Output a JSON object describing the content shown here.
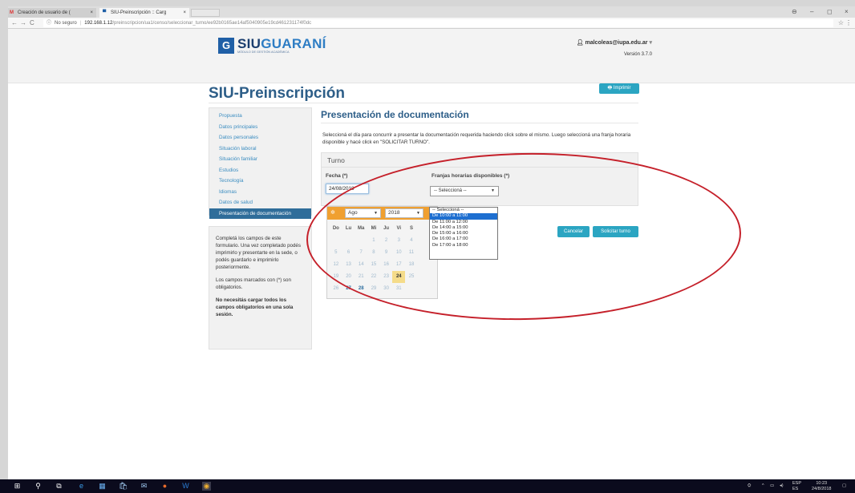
{
  "browser": {
    "tabs": [
      {
        "label": "Creación de usuario de (",
        "icon": "gmail-icon"
      },
      {
        "label": "SIU-Preinscripción :: Carg",
        "icon": "siu-icon"
      }
    ],
    "close_glyph": "×",
    "url_security": "No seguro",
    "url_host": "192.168.1.12",
    "url_path": "/preinscripcion/ua1/censo/seleccionar_turno/ee92b0165ae14af5040905e19cd461231174f0dc",
    "window_controls": {
      "profile": "⊖",
      "minimize": "–",
      "maximize": "◻",
      "close": "×"
    }
  },
  "header": {
    "logo_mark": "G",
    "logo_siu": "SIU",
    "logo_guarani": "GUARANÍ",
    "logo_subtitle": "MÓDULO DE GESTIÓN ACADÉMICA",
    "user_email": "malcoleas@iupa.edu.ar",
    "version": "Versión 3.7.0"
  },
  "page": {
    "title": "SIU-Preinscripción",
    "print_button": "Imprimir"
  },
  "sidebar": {
    "items": [
      {
        "label": "Propuesta",
        "active": false
      },
      {
        "label": "Datos principales",
        "active": false
      },
      {
        "label": "Datos personales",
        "active": false
      },
      {
        "label": "Situación laboral",
        "active": false
      },
      {
        "label": "Situación familiar",
        "active": false
      },
      {
        "label": "Estudios",
        "active": false
      },
      {
        "label": "Tecnología",
        "active": false
      },
      {
        "label": "Idiomas",
        "active": false
      },
      {
        "label": "Datos de salud",
        "active": false
      },
      {
        "label": "Presentación de documentación",
        "active": true
      }
    ],
    "info": {
      "p1": "Completá los campos de este formulario. Una vez completado podés imprimirlo y presentarte en la sede, o podés guardarlo e imprimirlo posteriormente.",
      "p2": "Los campos marcados con (*) son obligatorios.",
      "p3": "No necesitás cargar todos los campos obligatorios en una sola sesión."
    }
  },
  "main": {
    "title": "Presentación de documentación",
    "instructions": "Seleccioná el día para concurrir a presentar la documentación requerida haciendo click sobre el mismo. Luego seleccioná una franja horaria disponible y hacé click en \"SOLICITAR TURNO\".",
    "turno": {
      "heading": "Turno",
      "fecha_label": "Fecha (*)",
      "fecha_value": "24/08/2018",
      "franjas_label": "Franjas horarias disponibles (*)",
      "franjas_selected": "-- Seleccioná --",
      "options": [
        "-- Seleccioná --",
        "De 10:00 a 11:00",
        "De 11:00 a 12:00",
        "De 14:00 a 15:00",
        "De 15:00 a 16:00",
        "De 16:00 a 17:00",
        "De 17:00 a 18:00"
      ],
      "highlighted_option": 1
    },
    "buttons": {
      "cancel": "Cancelar",
      "submit": "Solicitar turno"
    }
  },
  "datepicker": {
    "month": "Ago",
    "year": "2018",
    "weekdays": [
      "Do",
      "Lu",
      "Ma",
      "Mi",
      "Ju",
      "Vi",
      "S"
    ],
    "weeks": [
      [
        "",
        "",
        "",
        "1",
        "2",
        "3",
        "4"
      ],
      [
        "5",
        "6",
        "7",
        "8",
        "9",
        "10",
        "11"
      ],
      [
        "12",
        "13",
        "14",
        "15",
        "16",
        "17",
        "18"
      ],
      [
        "19",
        "20",
        "21",
        "22",
        "23",
        "24",
        "25"
      ],
      [
        "26",
        "27",
        "28",
        "29",
        "30",
        "31",
        ""
      ]
    ],
    "selected_day": "24",
    "available_days": [
      "27",
      "28"
    ]
  },
  "taskbar": {
    "lang_top": "ESP",
    "lang_bottom": "ES",
    "time": "10:23",
    "date": "24/8/2018"
  },
  "colors": {
    "brand_blue": "#2d5e88",
    "accent_teal": "#2ba5c2",
    "datepicker_orange": "#f0a030",
    "annotation_red": "#c5202a"
  }
}
